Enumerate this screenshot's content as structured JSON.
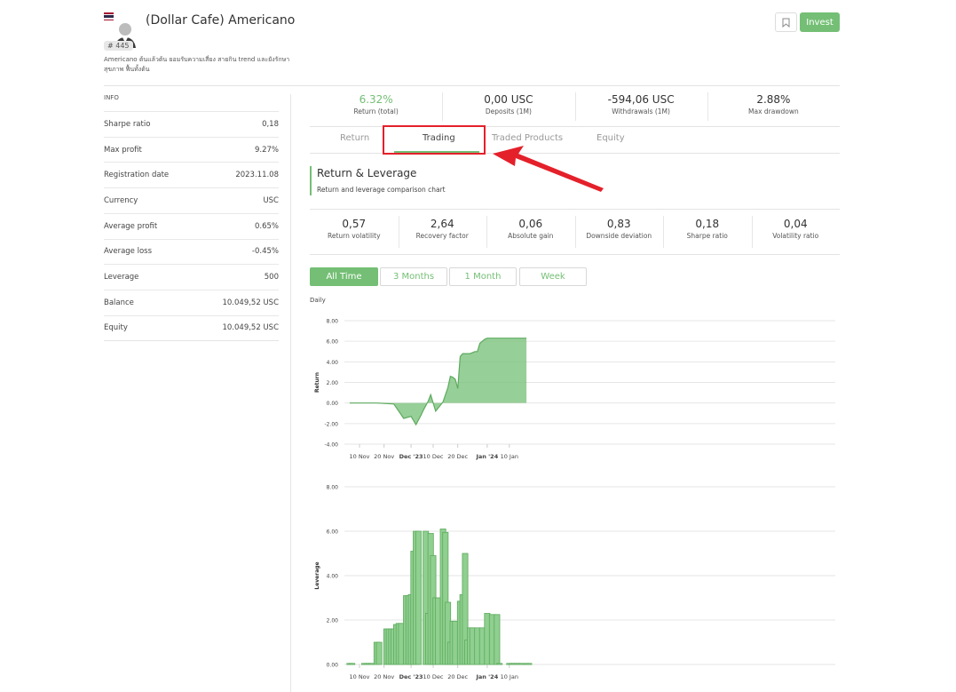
{
  "header": {
    "title": "(Dollar Cafe) Americano",
    "rank": "# 445",
    "description": "Americano ต้นแล้วต้น ยอมรับความเสี่ยง สายกิน trend และยังรักษาสุขภาพ ฟื้นทั้งต้น",
    "invest_label": "Invest"
  },
  "info": {
    "title": "INFO",
    "rows": [
      {
        "label": "Sharpe ratio",
        "value": "0,18"
      },
      {
        "label": "Max profit",
        "value": "9.27%"
      },
      {
        "label": "Registration date",
        "value": "2023.11.08"
      },
      {
        "label": "Currency",
        "value": "USC"
      },
      {
        "label": "Average profit",
        "value": "0.65%"
      },
      {
        "label": "Average loss",
        "value": "-0.45%"
      },
      {
        "label": "Leverage",
        "value": "500"
      },
      {
        "label": "Balance",
        "value": "10.049,52 USC"
      },
      {
        "label": "Equity",
        "value": "10.049,52 USC"
      }
    ]
  },
  "stats": [
    {
      "value": "6.32%",
      "label": "Return (total)",
      "color": "#74bf75"
    },
    {
      "value": "0,00 USC",
      "label": "Deposits (1M)",
      "color": "#333333"
    },
    {
      "value": "-594,06 USC",
      "label": "Withdrawals (1M)",
      "color": "#333333"
    },
    {
      "value": "2.88%",
      "label": "Max drawdown",
      "color": "#333333"
    }
  ],
  "tabs": [
    {
      "label": "Return"
    },
    {
      "label": "Trading"
    },
    {
      "label": "Traded Products"
    },
    {
      "label": "Equity"
    }
  ],
  "section": {
    "title": "Return & Leverage",
    "subtitle": "Return and leverage comparison chart"
  },
  "metrics": [
    {
      "value": "0,57",
      "label": "Return volatility"
    },
    {
      "value": "2,64",
      "label": "Recovery factor"
    },
    {
      "value": "0,06",
      "label": "Absolute gain"
    },
    {
      "value": "0,83",
      "label": "Downside deviation"
    },
    {
      "value": "0,18",
      "label": "Sharpe ratio"
    },
    {
      "value": "0,04",
      "label": "Volatility ratio"
    }
  ],
  "ranges": [
    {
      "label": "All Time"
    },
    {
      "label": "3 Months"
    },
    {
      "label": "1 Month"
    },
    {
      "label": "Week"
    }
  ],
  "daily_label": "Daily",
  "colors": {
    "accent": "#74bf75",
    "highlight": "#e4202a"
  },
  "chart_data": [
    {
      "type": "area",
      "ylabel": "Return",
      "ylim": [
        -4,
        8
      ],
      "yticks": [
        "8.00",
        "6.00",
        "4.00",
        "2.00",
        "0.00",
        "-2.00",
        "-4.00"
      ],
      "xticks": [
        "10 Nov",
        "20 Nov",
        "Dec '23",
        "10 Dec",
        "20 Dec",
        "Jan '24",
        "10 Jan"
      ],
      "x": [
        "Nov 06",
        "Nov 17",
        "Nov 24",
        "Nov 28",
        "Dec 01",
        "Dec 03",
        "Dec 05",
        "Dec 06",
        "Dec 08",
        "Dec 09",
        "Dec 11",
        "Dec 14",
        "Dec 16",
        "Dec 17",
        "Dec 18",
        "Dec 19",
        "Dec 20",
        "Dec 21",
        "Dec 22",
        "Dec 23",
        "Dec 25",
        "Dec 27",
        "Dec 28",
        "Dec 29",
        "Dec 30",
        "Dec 31",
        "Jan 01",
        "Jan 03",
        "Jan 05",
        "Jan 10",
        "Jan 17"
      ],
      "values": [
        0,
        0,
        -0.1,
        -1.5,
        -1.3,
        -2.1,
        -1.2,
        -0.7,
        0.2,
        0.8,
        -0.8,
        0.1,
        1.5,
        2.6,
        2.5,
        2.3,
        1.4,
        4.5,
        4.8,
        4.8,
        4.8,
        5.0,
        5.0,
        5.8,
        6.0,
        6.2,
        6.3,
        6.3,
        6.3,
        6.3,
        6.3
      ]
    },
    {
      "type": "bar",
      "ylabel": "Leverage",
      "ylim": [
        0,
        8
      ],
      "yticks": [
        "8.00",
        "6.00",
        "4.00",
        "2.00",
        "0.00"
      ],
      "xticks": [
        "10 Nov",
        "20 Nov",
        "Dec '23",
        "10 Dec",
        "20 Dec",
        "Jan '24",
        "10 Jan"
      ],
      "x": [
        "Nov 06",
        "Nov 07",
        "Nov 12",
        "Nov 13",
        "Nov 14",
        "Nov 15",
        "Nov 17",
        "Nov 18",
        "Nov 21",
        "Nov 22",
        "Nov 23",
        "Nov 24",
        "Nov 25",
        "Nov 26",
        "Nov 27",
        "Nov 29",
        "Nov 30",
        "Dec 01",
        "Dec 02",
        "Dec 03",
        "Dec 04",
        "Dec 05",
        "Dec 07",
        "Dec 08",
        "Dec 09",
        "Dec 10",
        "Dec 11",
        "Dec 12",
        "Dec 14",
        "Dec 15",
        "Dec 16",
        "Dec 17",
        "Dec 18",
        "Dec 19",
        "Dec 20",
        "Dec 21",
        "Dec 22",
        "Dec 23",
        "Dec 24",
        "Dec 25",
        "Dec 26",
        "Dec 27",
        "Dec 28",
        "Dec 30",
        "Dec 31",
        "Jan 01",
        "Jan 03",
        "Jan 04",
        "Jan 05",
        "Jan 06",
        "Jan 10",
        "Jan 11",
        "Jan 12",
        "Jan 13",
        "Jan 14",
        "Jan 15",
        "Jan 17",
        "Jan 18"
      ],
      "values": [
        0.05,
        0.05,
        0.05,
        0.05,
        0.05,
        0.05,
        1.0,
        1.0,
        1.6,
        1.6,
        1.6,
        1.6,
        1.8,
        1.85,
        1.85,
        3.1,
        3.1,
        3.15,
        5.1,
        6.0,
        6.0,
        0,
        6.0,
        2.3,
        5.9,
        4.9,
        3.0,
        3.0,
        6.1,
        5.95,
        2.8,
        1.0,
        1.95,
        1.95,
        0,
        2.85,
        3.15,
        5.0,
        1.1,
        1.65,
        1.65,
        0,
        1.65,
        1.65,
        0,
        2.3,
        2.25,
        0,
        2.25,
        0.05,
        0.05,
        0.05,
        0.05,
        0.05,
        0.05,
        0.05,
        0.05,
        0.05
      ]
    }
  ]
}
